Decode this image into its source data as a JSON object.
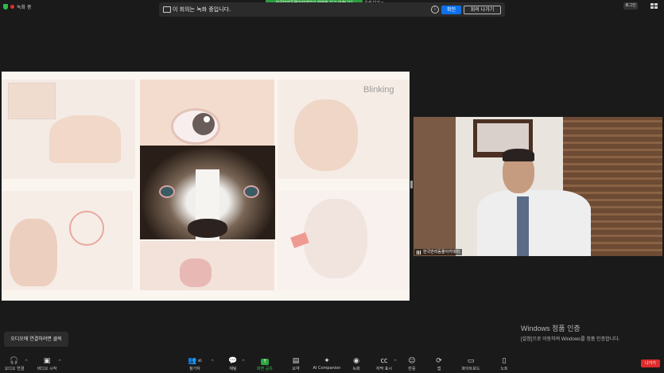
{
  "recording": {
    "label": "녹화 중"
  },
  "share_banner": {
    "text": "한국반려동물아카데미의 화면을 보고 있습니다",
    "view_options": "옵션 보기"
  },
  "record_notice": {
    "message": "이 회의는 녹화 중입니다.",
    "ok_label": "확인",
    "leave_label": "회의 나가기"
  },
  "top_right": {
    "login_label": "로그인"
  },
  "slide": {
    "title": "Blinking"
  },
  "video": {
    "participant_name": "한국반려동물아카데미"
  },
  "audio_tooltip": "오디오에 연결하려면 클릭",
  "windows_activation": {
    "title": "Windows 정품 인증",
    "subtitle": "[설정]으로 이동하여 Windows를 정품 인증합니다."
  },
  "toolbar": {
    "audio": "오디오 연결",
    "video": "비디오 시작",
    "participants": "참가자",
    "participants_count": "46",
    "chat": "채팅",
    "share": "화면 공유",
    "summary": "요약",
    "ai": "AI Companion",
    "record": "녹화",
    "captions": "자막 표시",
    "reactions": "반응",
    "apps": "앱",
    "whiteboard": "화이트보드",
    "notes": "노트",
    "leave": "나가기"
  },
  "colors": {
    "accent_blue": "#0e71eb",
    "share_green": "#2fa644",
    "leave_red": "#e02b2b"
  }
}
